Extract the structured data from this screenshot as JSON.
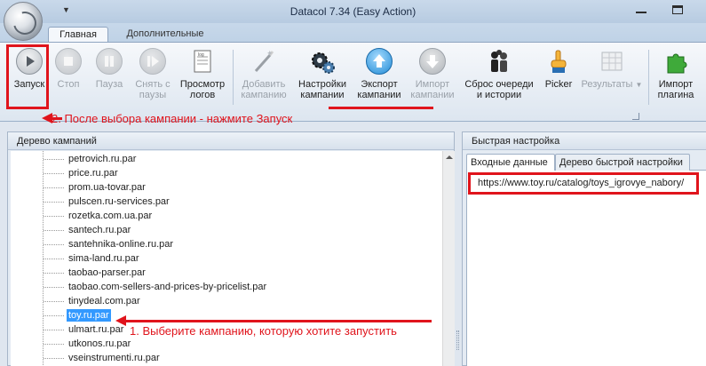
{
  "window": {
    "title": "Datacol 7.34 (Easy Action)"
  },
  "ribbon_tabs": [
    {
      "label": "Главная"
    },
    {
      "label": "Дополнительные"
    }
  ],
  "toolbar": {
    "start": {
      "label": "Запуск"
    },
    "stop": {
      "label": "Стоп"
    },
    "pause": {
      "label": "Пауза"
    },
    "unpause": {
      "line1": "Снять с",
      "line2": "паузы"
    },
    "view_logs": {
      "line1": "Просмотр",
      "line2": "логов"
    },
    "add_campaign": {
      "line1": "Добавить",
      "line2": "кампанию"
    },
    "campaign_settings": {
      "line1": "Настройки",
      "line2": "кампании"
    },
    "export_campaign": {
      "line1": "Экспорт",
      "line2": "кампании"
    },
    "import_campaign": {
      "line1": "Импорт",
      "line2": "кампании"
    },
    "reset_queue": {
      "line1": "Сброс очереди",
      "line2": "и истории"
    },
    "picker": {
      "label": "Picker"
    },
    "results": {
      "label": "Результаты"
    },
    "import_plugin": {
      "line1": "Импорт",
      "line2": "плагина"
    }
  },
  "campaign_tree": {
    "header": "Дерево кампаний",
    "items": [
      "petrovich.ru.par",
      "price.ru.par",
      "prom.ua-tovar.par",
      "pulscen.ru-services.par",
      "rozetka.com.ua.par",
      "santech.ru.par",
      "santehnika-online.ru.par",
      "sima-land.ru.par",
      "taobao-parser.par",
      "taobao.com-sellers-and-prices-by-pricelist.par",
      "tinydeal.com.par",
      "toy.ru.par",
      "ulmart.ru.par",
      "utkonos.ru.par",
      "vseinstrumenti.ru.par"
    ],
    "selected": "toy.ru.par"
  },
  "quick_setup": {
    "header": "Быстрая настройка",
    "tabs": [
      {
        "label": "Входные данные"
      },
      {
        "label": "Дерево быстрой настройки"
      }
    ],
    "input_url": "https://www.toy.ru/catalog/toys_igrovye_nabory/"
  },
  "annotations": {
    "step1": "1. Выберите кампанию, которую хотите запустить",
    "step2": "2. После выбора кампании - нажмите Запуск"
  },
  "colors": {
    "annotation": "#e0141c",
    "selection": "#3399ff"
  }
}
